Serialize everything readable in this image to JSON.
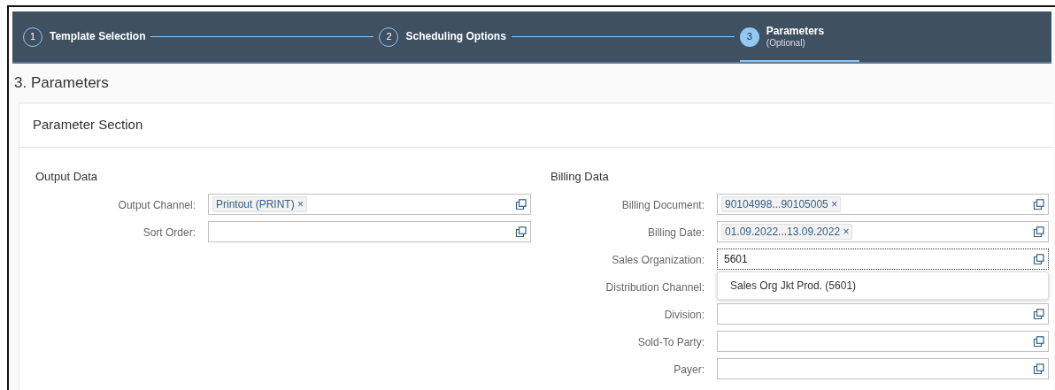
{
  "wizard": {
    "steps": [
      {
        "number": "1",
        "label": "Template Selection",
        "selected": false
      },
      {
        "number": "2",
        "label": "Scheduling Options",
        "selected": false
      },
      {
        "number": "3",
        "label": "Parameters",
        "sublabel": "(Optional)",
        "selected": true
      }
    ]
  },
  "page_title": "3. Parameters",
  "section": {
    "title": "Parameter Section",
    "groups": [
      {
        "title": "Output Data",
        "fields": [
          {
            "kind": "tokens",
            "label": "Output Channel:",
            "tokens": [
              {
                "text": "Printout (PRINT)",
                "remove": "×"
              }
            ]
          },
          {
            "kind": "text",
            "label": "Sort Order:"
          }
        ]
      },
      {
        "title": "Billing Data",
        "fields": [
          {
            "kind": "tokens",
            "label": "Billing Document:",
            "tokens": [
              {
                "text": "90104998...90105005",
                "remove": "×"
              }
            ]
          },
          {
            "kind": "tokens",
            "label": "Billing Date:",
            "tokens": [
              {
                "text": "01.09.2022...13.09.2022",
                "remove": "×"
              }
            ]
          },
          {
            "kind": "text",
            "label": "Sales Organization:",
            "value": "5601",
            "focused": true,
            "suggestions": [
              "Sales Org Jkt Prod. (5601)"
            ]
          },
          {
            "kind": "covered",
            "label": "Distribution Channel:"
          },
          {
            "kind": "text",
            "label": "Division:"
          },
          {
            "kind": "text",
            "label": "Sold-To Party:"
          },
          {
            "kind": "text",
            "label": "Payer:"
          }
        ]
      }
    ]
  }
}
